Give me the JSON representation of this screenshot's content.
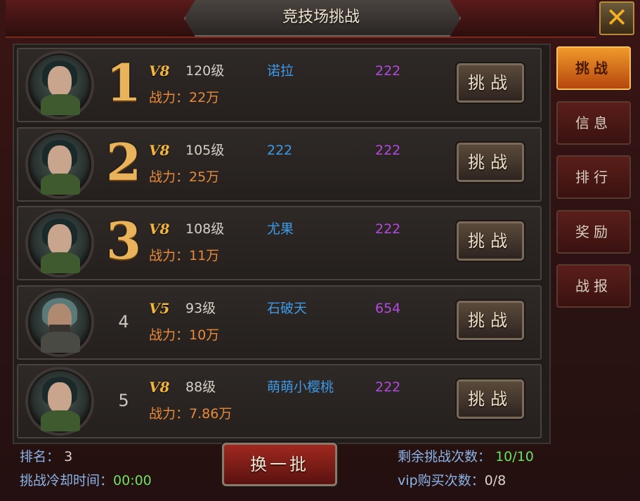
{
  "title": "竞技场挑战",
  "close_icon": "close-icon",
  "tabs": [
    {
      "label": "挑战",
      "active": true
    },
    {
      "label": "信息",
      "active": false
    },
    {
      "label": "排行",
      "active": false
    },
    {
      "label": "奖励",
      "active": false
    },
    {
      "label": "战报",
      "active": false
    }
  ],
  "rows": [
    {
      "rank": "1",
      "vip": "V8",
      "level": "120级",
      "name": "诺拉",
      "score": "222",
      "power": "战力：22万",
      "button": "挑战"
    },
    {
      "rank": "2",
      "vip": "V8",
      "level": "105级",
      "name": "222",
      "score": "222",
      "power": "战力：25万",
      "button": "挑战"
    },
    {
      "rank": "3",
      "vip": "V8",
      "level": "108级",
      "name": "尤果",
      "score": "222",
      "power": "战力：11万",
      "button": "挑战"
    },
    {
      "rank": "4",
      "vip": "V5",
      "level": "93级",
      "name": "石破天",
      "score": "654",
      "power": "战力：10万",
      "button": "挑战"
    },
    {
      "rank": "5",
      "vip": "V8",
      "level": "88级",
      "name": "萌萌小樱桃",
      "score": "222",
      "power": "战力：7.86万",
      "button": "挑战"
    }
  ],
  "footer": {
    "rank_label": "排名：",
    "rank_value": "3",
    "cooldown_label": "挑战冷却时间：",
    "cooldown_value": "00:00",
    "swap_button": "换一批",
    "remaining_label": "剩余挑战次数：",
    "remaining_value": "10/10",
    "vip_label": "vip购买次数：",
    "vip_value": "0/8"
  }
}
